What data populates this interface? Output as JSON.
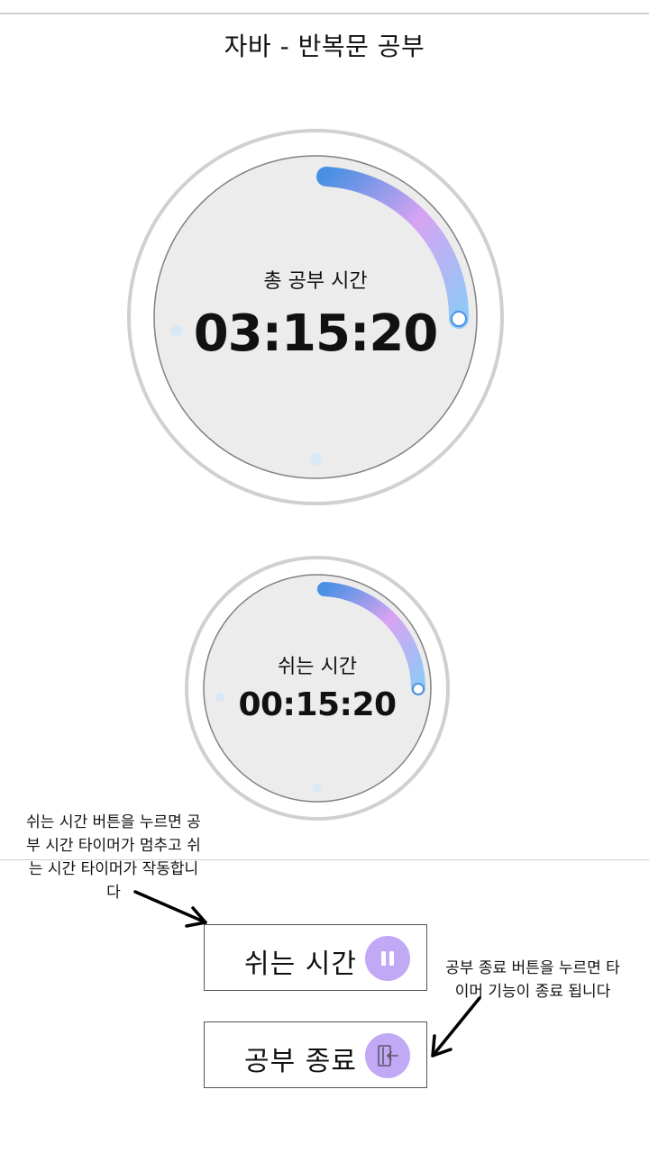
{
  "header": {
    "title": "자바 - 반복문 공부"
  },
  "timers": {
    "total": {
      "label": "총 공부 시간",
      "value": "03:15:20",
      "progress": 0.25
    },
    "rest": {
      "label": "쉬는 시간",
      "value": "00:15:20",
      "progress": 0.25
    }
  },
  "buttons": {
    "rest": {
      "label": "쉬는 시간",
      "icon": "pause-icon"
    },
    "end": {
      "label": "공부 종료",
      "icon": "exit-door-icon"
    }
  },
  "annotations": {
    "rest_note": [
      "쉬는 시간 버튼을 누르면 공",
      "부 시간 타이머가 멈추고 쉬",
      "는 시간 타이머가 작동합니",
      "다"
    ],
    "end_note": [
      "공부 종료 버튼을 누르면 타",
      "이머 기능이 종료 됩니다"
    ]
  },
  "colors": {
    "arc_start": "#4a90e2",
    "arc_mid": "#d7a3f2",
    "arc_end": "#8ec9f7",
    "button_icon_bg": "#c2a9f5"
  }
}
